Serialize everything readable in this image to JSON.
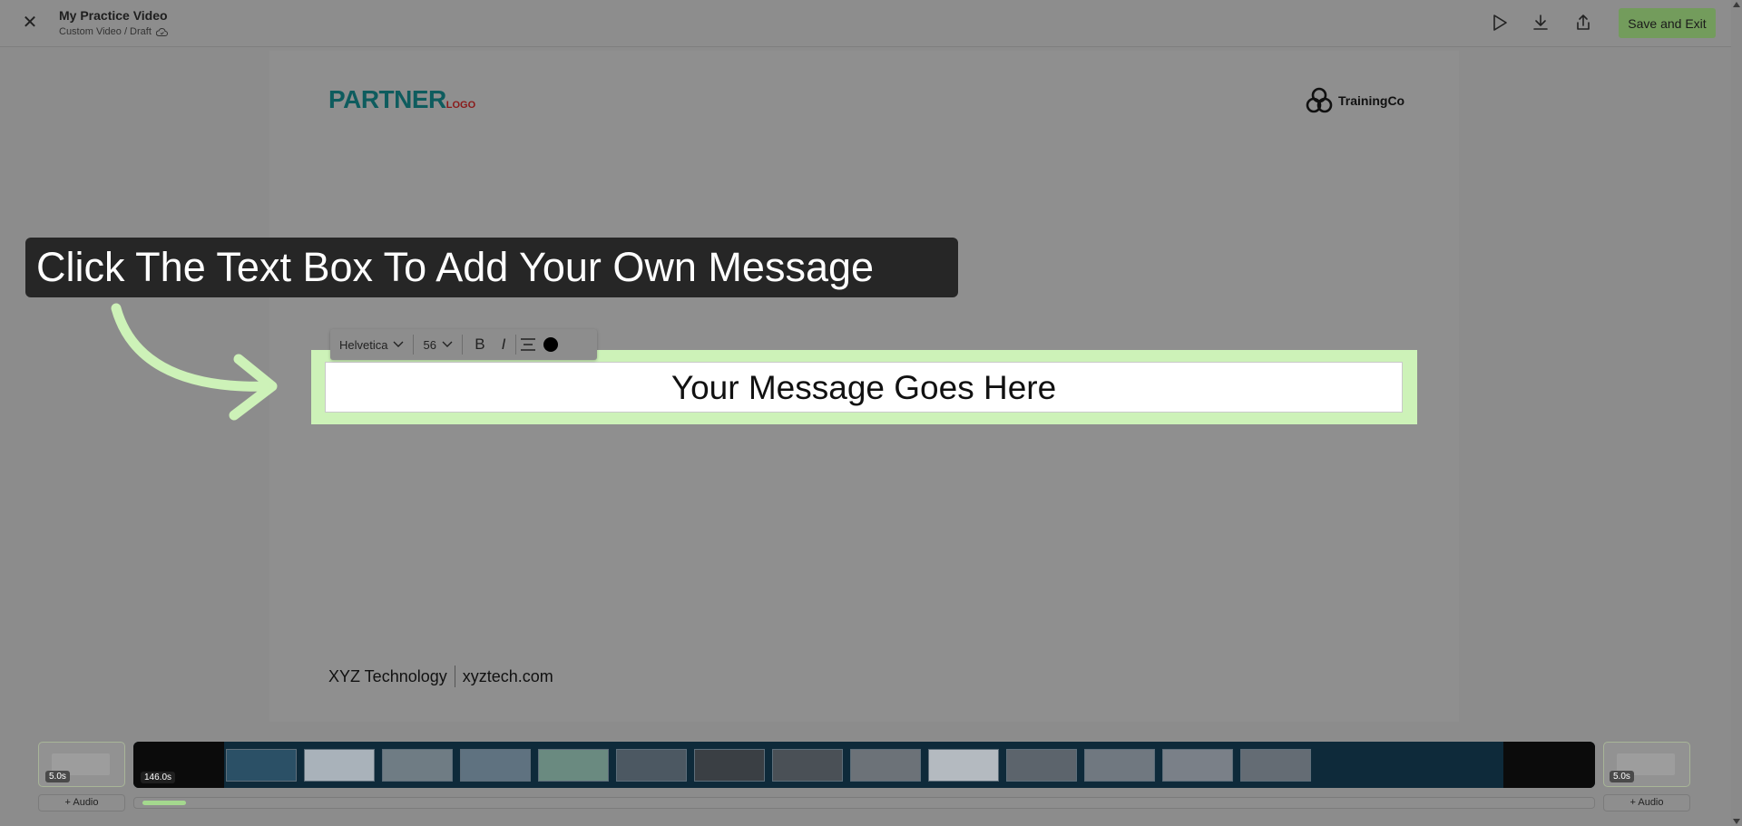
{
  "header": {
    "title": "My Practice Video",
    "subtitle": "Custom Video / Draft",
    "save_label": "Save and Exit"
  },
  "canvas": {
    "partner_logo_main": "PARTNER",
    "partner_logo_sub": "LOGO",
    "brand_name": "TrainingCo",
    "footer_company": "XYZ Technology",
    "footer_url": "xyztech.com"
  },
  "toolbar": {
    "font": "Helvetica",
    "size": "56",
    "bold_label": "B",
    "italic_label": "I",
    "text_color": "#000000"
  },
  "text_box": {
    "value": "Your Message Goes Here"
  },
  "callout": {
    "text": "Click The Text Box To Add Your Own Message",
    "highlight_color": "#cdf2b8"
  },
  "timeline": {
    "left_duration": "5.0s",
    "main_duration": "146.0s",
    "right_duration": "5.0s",
    "audio_label": "Audio",
    "progress_fraction": 0.03
  },
  "colors": {
    "accent": "#739c5c",
    "overlay": "#8c8c8c"
  }
}
